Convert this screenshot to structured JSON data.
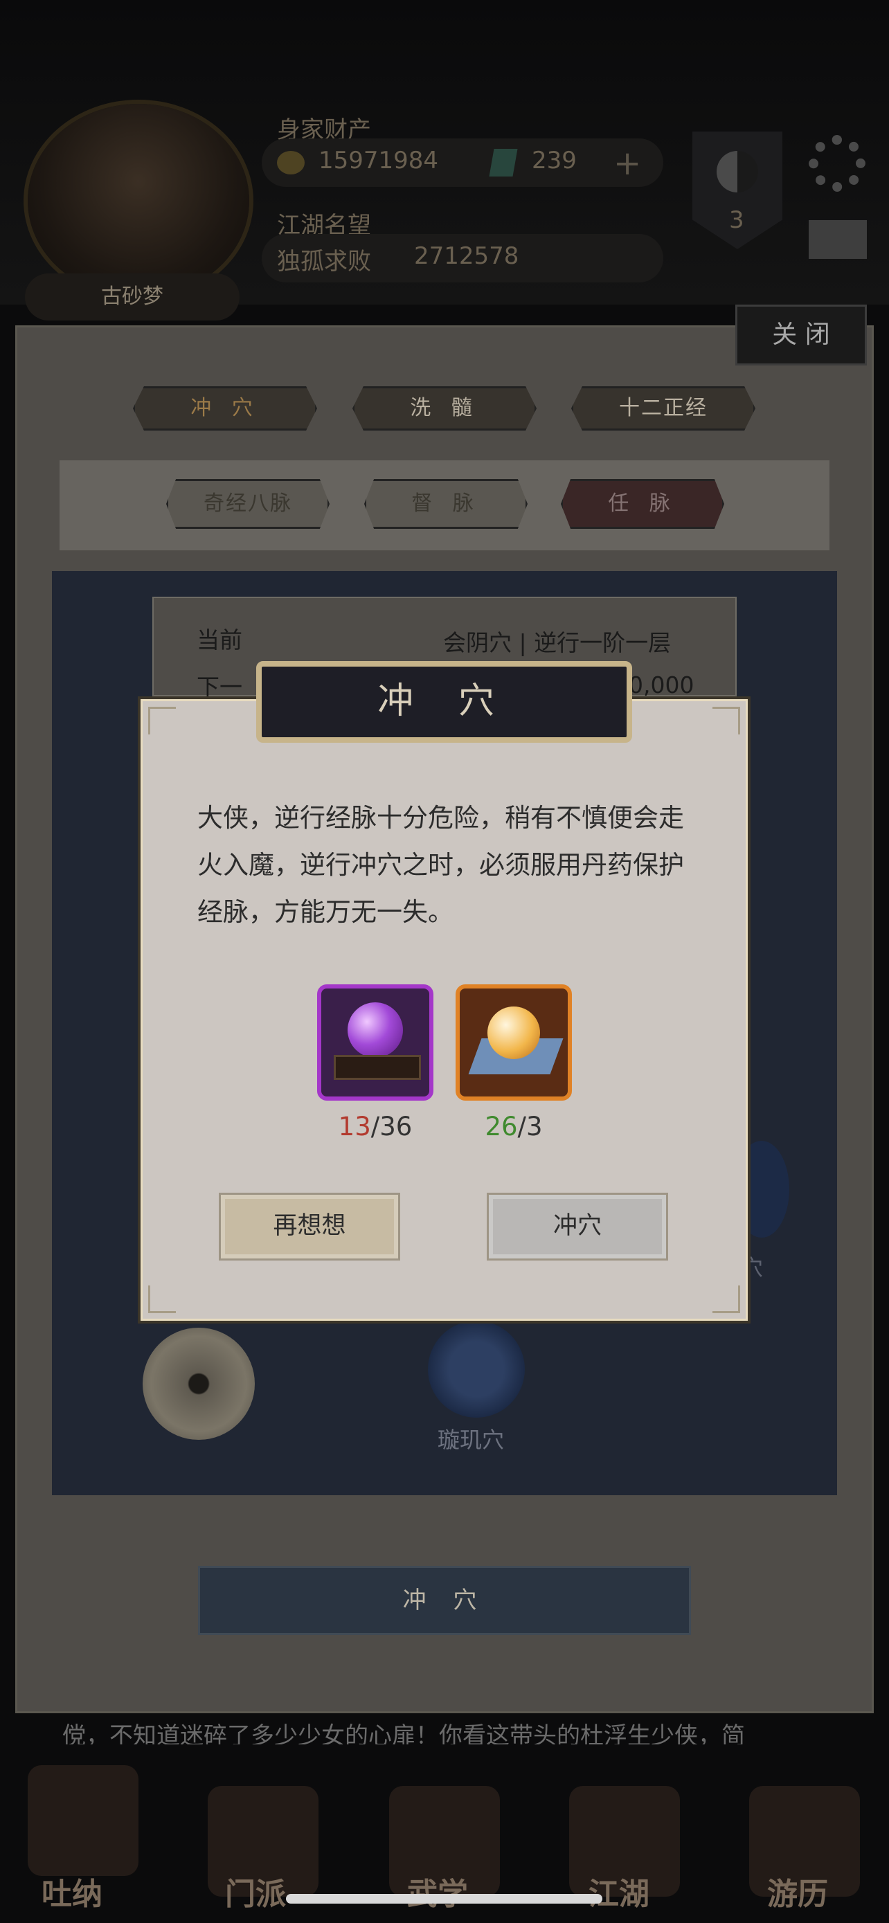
{
  "header": {
    "assets_label": "身家财产",
    "gold": "15971984",
    "jade": "239",
    "fame_label": "江湖名望",
    "fame_title": "独孤求败",
    "fame_value": "2712578",
    "rank_level": "3",
    "player_name": "古砂梦"
  },
  "panel": {
    "close_label": "关 闭",
    "tabs": [
      "冲 穴",
      "洗 髓",
      "十二正经"
    ],
    "subtabs": [
      "奇经八脉",
      "督 脉",
      "任 脉"
    ],
    "info_current_label": "当前",
    "info_current_value": "会阴穴 | 逆行一阶一层",
    "info_next_label": "下一",
    "info_next_value": "0,000",
    "node_label_1": "璇玑穴",
    "node_label_2": "穴",
    "action_button": "冲 穴",
    "ticker_text": "傥，不知道迷碎了多少少女的心扉！你看这带头的杜浮生少侠，简"
  },
  "bottom_nav": [
    "吐纳",
    "门派",
    "武学",
    "江湖",
    "游历"
  ],
  "modal": {
    "title": "冲 穴",
    "message": "大侠，逆行经脉十分危险，稍有不慎便会走火入魔，逆行冲穴之时，必须服用丹药保护经脉，方能万无一失。",
    "items": [
      {
        "icon": "purple-orb-icon",
        "owned": "13",
        "required": "/36"
      },
      {
        "icon": "golden-pill-icon",
        "owned": "26",
        "required": "/3"
      }
    ],
    "cancel_label": "再想想",
    "confirm_label": "冲穴"
  }
}
